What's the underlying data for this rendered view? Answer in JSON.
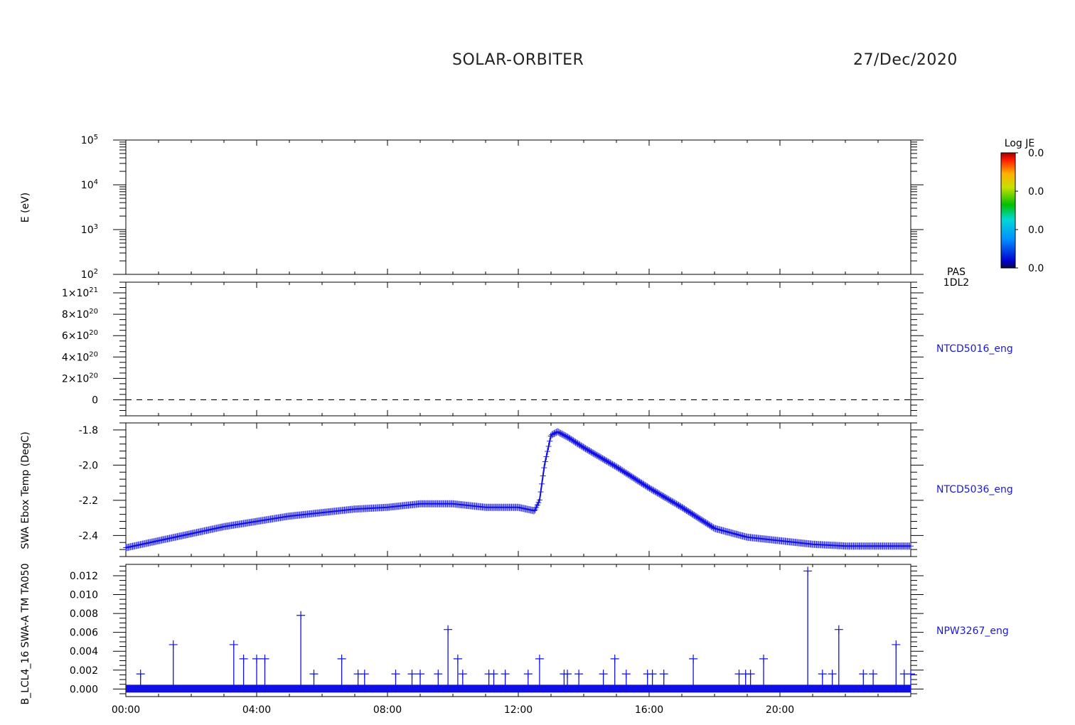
{
  "header": {
    "mission": "SOLAR-ORBITER",
    "date": "27/Dec/2020"
  },
  "colorbar": {
    "title": "Log JE",
    "ticks": [
      "0.0",
      "0.0",
      "0.0",
      "0.0"
    ]
  },
  "chart_data": [
    {
      "type": "heatmap",
      "panel": "energy-spectrogram",
      "ylabel": "E (eV)",
      "yscale": "log",
      "ylim": [
        100,
        100000
      ],
      "ytick_labels": [
        {
          "base": "10",
          "exp": "2"
        },
        {
          "base": "10",
          "exp": "3"
        },
        {
          "base": "10",
          "exp": "4"
        },
        {
          "base": "10",
          "exp": "5"
        }
      ],
      "right_label": [
        "PAS",
        "1DL2"
      ],
      "values": []
    },
    {
      "type": "line",
      "panel": "ntcd5016",
      "ylabel": "",
      "ylim": [
        -1.5e+20,
        1.1e+21
      ],
      "ytick_labels": [
        {
          "base": "0",
          "exp": ""
        },
        {
          "base": "2×10",
          "exp": "20"
        },
        {
          "base": "4×10",
          "exp": "20"
        },
        {
          "base": "6×10",
          "exp": "20"
        },
        {
          "base": "8×10",
          "exp": "20"
        },
        {
          "base": "1×10",
          "exp": "21"
        }
      ],
      "right_label": "NTCD5016_eng",
      "reference_line": 0,
      "series": []
    },
    {
      "type": "line",
      "panel": "ntcd5036",
      "ylabel": "SWA Ebox Temp (DegC)",
      "ylim": [
        -2.52,
        -1.76
      ],
      "ytick_labels": [
        "-2.4",
        "-2.2",
        "-2.0",
        "-1.8"
      ],
      "right_label": "NTCD5036_eng",
      "x": [
        0,
        1,
        2,
        3,
        4,
        5,
        6,
        7,
        8,
        9,
        10,
        11,
        12,
        12.5,
        12.65,
        12.8,
        13.0,
        13.2,
        13.5,
        14,
        15,
        16,
        17,
        18,
        19,
        20,
        21,
        22,
        23,
        24
      ],
      "values": [
        -2.47,
        -2.43,
        -2.39,
        -2.35,
        -2.32,
        -2.29,
        -2.27,
        -2.25,
        -2.24,
        -2.22,
        -2.22,
        -2.24,
        -2.24,
        -2.26,
        -2.2,
        -2.0,
        -1.83,
        -1.81,
        -1.84,
        -1.9,
        -2.01,
        -2.13,
        -2.24,
        -2.36,
        -2.41,
        -2.43,
        -2.45,
        -2.46,
        -2.46,
        -2.46
      ]
    },
    {
      "type": "scatter",
      "panel": "npw3267",
      "ylabel": "B_LCL4_16 SWA-A TM TA050",
      "ylim": [
        -0.0008,
        0.0132
      ],
      "ytick_labels": [
        "0.000",
        "0.002",
        "0.004",
        "0.006",
        "0.008",
        "0.010",
        "0.012"
      ],
      "right_label": "NPW3267_eng",
      "baseline": 0.0,
      "x": [
        0.45,
        1.45,
        3.3,
        3.6,
        4.0,
        4.25,
        5.35,
        5.75,
        6.6,
        7.1,
        7.3,
        8.25,
        8.75,
        9.0,
        9.55,
        9.85,
        10.15,
        10.3,
        11.1,
        11.25,
        11.6,
        12.3,
        12.65,
        13.4,
        13.5,
        13.85,
        14.6,
        14.95,
        15.3,
        15.95,
        16.1,
        16.45,
        17.35,
        18.75,
        18.95,
        19.1,
        19.5,
        20.85,
        21.3,
        21.6,
        21.8,
        22.55,
        22.85,
        23.55,
        23.8,
        24.0
      ],
      "values": [
        0.0016,
        0.0047,
        0.0047,
        0.0032,
        0.0032,
        0.0032,
        0.0078,
        0.0016,
        0.0032,
        0.0016,
        0.0016,
        0.0016,
        0.0016,
        0.0016,
        0.0016,
        0.0063,
        0.0032,
        0.0016,
        0.0016,
        0.0016,
        0.0016,
        0.0016,
        0.0032,
        0.0016,
        0.0016,
        0.0016,
        0.0016,
        0.0032,
        0.0016,
        0.0016,
        0.0016,
        0.0016,
        0.0032,
        0.0016,
        0.0016,
        0.0016,
        0.0032,
        0.0125,
        0.0016,
        0.0016,
        0.0063,
        0.0016,
        0.0016,
        0.0047,
        0.0016,
        0.0016
      ]
    }
  ],
  "x_axis": {
    "xlim": [
      0,
      24
    ],
    "tick_labels": [
      "00:00",
      "04:00",
      "08:00",
      "12:00",
      "16:00",
      "20:00"
    ]
  }
}
